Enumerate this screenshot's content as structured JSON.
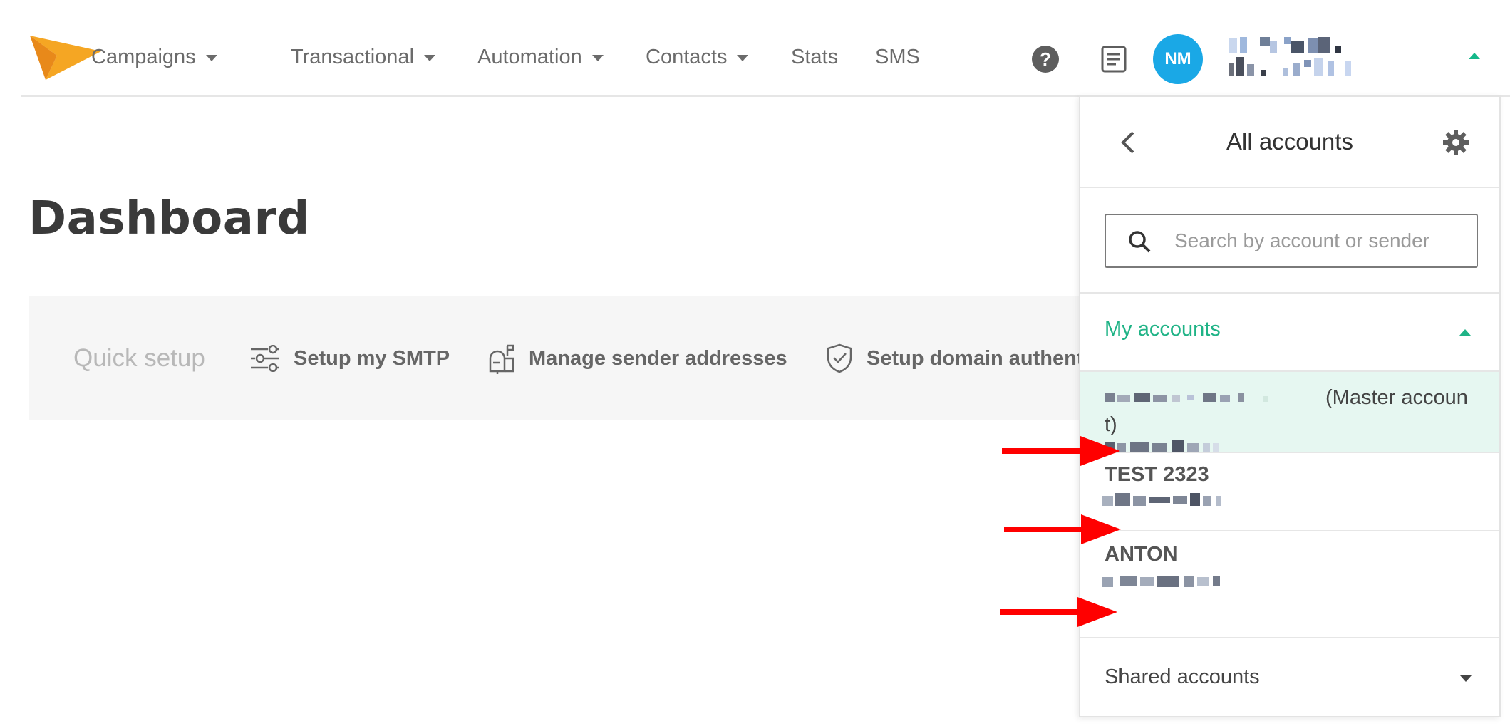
{
  "nav": {
    "items": [
      {
        "label": "Campaigns",
        "has_caret": true
      },
      {
        "label": "Transactional",
        "has_caret": true
      },
      {
        "label": "Automation",
        "has_caret": true
      },
      {
        "label": "Contacts",
        "has_caret": true
      },
      {
        "label": "Stats",
        "has_caret": false
      },
      {
        "label": "SMS",
        "has_caret": false
      }
    ],
    "help_icon_glyph": "?",
    "avatar_initials": "NM",
    "brand_color": "#f5a623",
    "accent_color": "#1aa8e6"
  },
  "page": {
    "title": "Dashboard"
  },
  "quick_setup": {
    "label": "Quick setup",
    "items": [
      {
        "label": "Setup my SMTP",
        "icon": "sliders-icon"
      },
      {
        "label": "Manage sender addresses",
        "icon": "mailbox-icon"
      },
      {
        "label": "Setup domain authenti",
        "icon": "shield-check-icon"
      }
    ]
  },
  "accounts_panel": {
    "title": "All accounts",
    "search_placeholder": "Search by account or sender",
    "my_accounts_label": "My accounts",
    "shared_accounts_label": "Shared accounts",
    "accounts": [
      {
        "name": "",
        "suffix_line1": "(Master accoun",
        "suffix_line2": "t)",
        "active": true
      },
      {
        "name": "TEST 2323",
        "active": false
      },
      {
        "name": "ANTON",
        "active": false
      }
    ],
    "active_bg": "#e6f7f1",
    "highlight_color": "#1fb386"
  },
  "annotation": {
    "arrow_color": "#ff0000",
    "arrow_count": 3
  }
}
